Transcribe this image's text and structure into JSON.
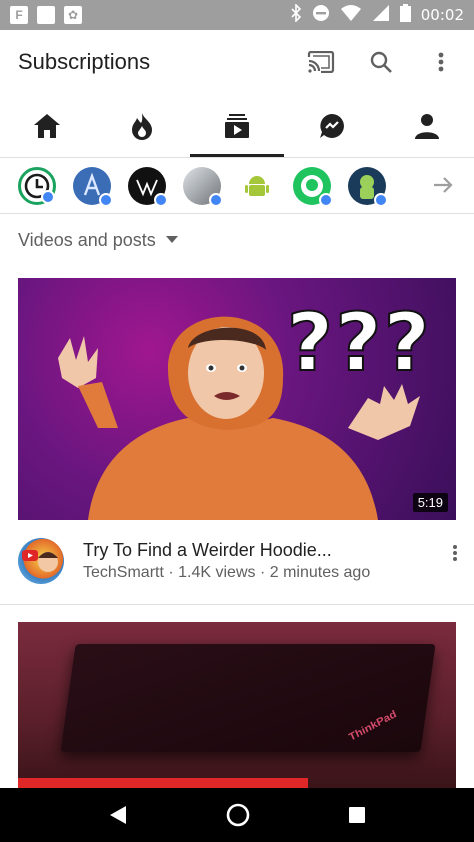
{
  "status_bar": {
    "time": "00:02",
    "left_icons": [
      "flipboard-icon",
      "app-icon",
      "photos-icon"
    ],
    "right_icons": [
      "bluetooth-icon",
      "dnd-icon",
      "wifi-icon",
      "signal-icon",
      "battery-icon"
    ]
  },
  "app_bar": {
    "title": "Subscriptions",
    "actions": [
      "cast-icon",
      "search-icon",
      "more-vert-icon"
    ]
  },
  "tabs": [
    {
      "name": "home",
      "icon": "home-icon",
      "active": false
    },
    {
      "name": "trending",
      "icon": "flame-icon",
      "active": false
    },
    {
      "name": "subscriptions",
      "icon": "subscriptions-icon",
      "active": true
    },
    {
      "name": "shared",
      "icon": "chat-share-icon",
      "active": false
    },
    {
      "name": "account",
      "icon": "person-icon",
      "active": false
    }
  ],
  "channels": [
    {
      "icon": "clock-avatar",
      "color": "#1aa35e",
      "new": true
    },
    {
      "icon": "a-avatar",
      "color": "#3a6db5",
      "new": true
    },
    {
      "icon": "w-avatar",
      "color": "#111111",
      "new": true
    },
    {
      "icon": "photo-avatar",
      "color": "#9aa0a6",
      "new": true
    },
    {
      "icon": "android-avatar",
      "color": "#ffffff",
      "new": false
    },
    {
      "icon": "green-avatar",
      "color": "#1fc45f",
      "new": true
    },
    {
      "icon": "android-dark-avatar",
      "color": "#1b3b5a",
      "new": true
    }
  ],
  "filter": {
    "label": "Videos and posts"
  },
  "videos": [
    {
      "title": "Try To Find a Weirder Hoodie...",
      "subtitle": "TechSmartt · 1.4K views · 2 minutes ago",
      "duration": "5:19",
      "overlay_text": "???"
    },
    {
      "laptop_logo": "ThinkPad"
    }
  ],
  "colors": {
    "accent": "#212121",
    "new_dot": "#4285f4",
    "status_bar": "#9e9e9e"
  }
}
